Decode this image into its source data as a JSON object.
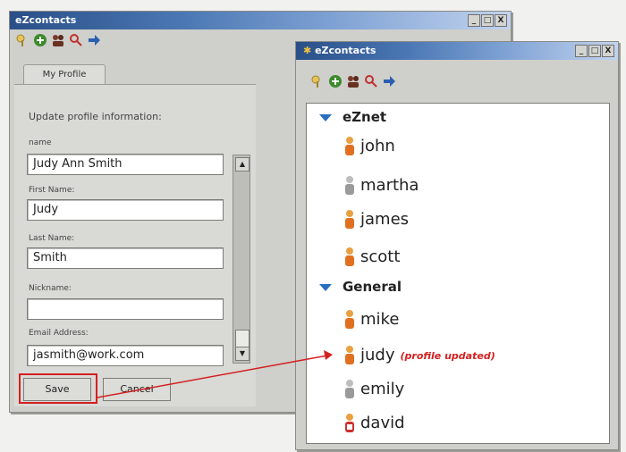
{
  "back_window": {
    "title": "eZcontacts",
    "tab": "My Profile",
    "heading": "Update profile information:",
    "fields": [
      {
        "label": "name",
        "value": "Judy Ann Smith"
      },
      {
        "label": "First Name:",
        "value": "Judy"
      },
      {
        "label": "Last Name:",
        "value": "Smith"
      },
      {
        "label": "Nickname:",
        "value": ""
      },
      {
        "label": "Email Address:",
        "value": "jasmith@work.com"
      }
    ],
    "buttons": {
      "save": "Save",
      "cancel": "Cancel"
    }
  },
  "front_window": {
    "title": "eZcontacts",
    "groups": [
      {
        "name": "eZnet",
        "contacts": [
          "john",
          "martha",
          "james",
          "scott"
        ]
      },
      {
        "name": "General",
        "contacts": [
          "mike",
          "judy",
          "emily",
          "david"
        ]
      }
    ],
    "annotation": "(profile updated)"
  },
  "colors": {
    "accent": "#2a6fc0",
    "highlight": "#d42020"
  }
}
